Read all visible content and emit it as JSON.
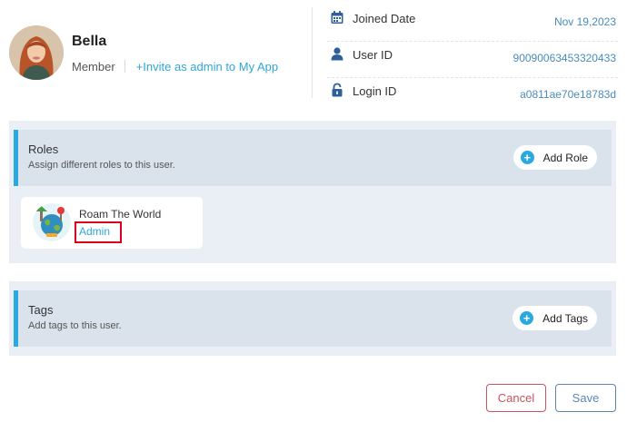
{
  "user": {
    "name": "Bella",
    "role": "Member",
    "invite_label": "+Invite as admin to My App"
  },
  "meta": [
    {
      "icon": "calendar-icon",
      "label": "Joined Date",
      "value": "Nov 19,2023"
    },
    {
      "icon": "user-icon",
      "label": "User ID",
      "value": "90090063453320433"
    },
    {
      "icon": "lock-icon",
      "label": "Login ID",
      "value": "a0811ae70e18783d"
    }
  ],
  "roles": {
    "title": "Roles",
    "subtitle": "Assign different roles to this user.",
    "add_label": "Add Role",
    "apps": [
      {
        "name": "Roam The World",
        "role": "Admin"
      }
    ]
  },
  "tags": {
    "title": "Tags",
    "subtitle": "Add tags to this user.",
    "add_label": "Add Tags"
  },
  "actions": {
    "cancel_label": "Cancel",
    "save_label": "Save"
  },
  "colors": {
    "accent": "#2aa9e0",
    "link": "#2fa6d8",
    "panel_bg": "#eaeff6",
    "panel_head_bg": "#dae3ec",
    "cancel": "#c5565d",
    "save": "#5f86b3",
    "highlight": "#d9001b"
  }
}
